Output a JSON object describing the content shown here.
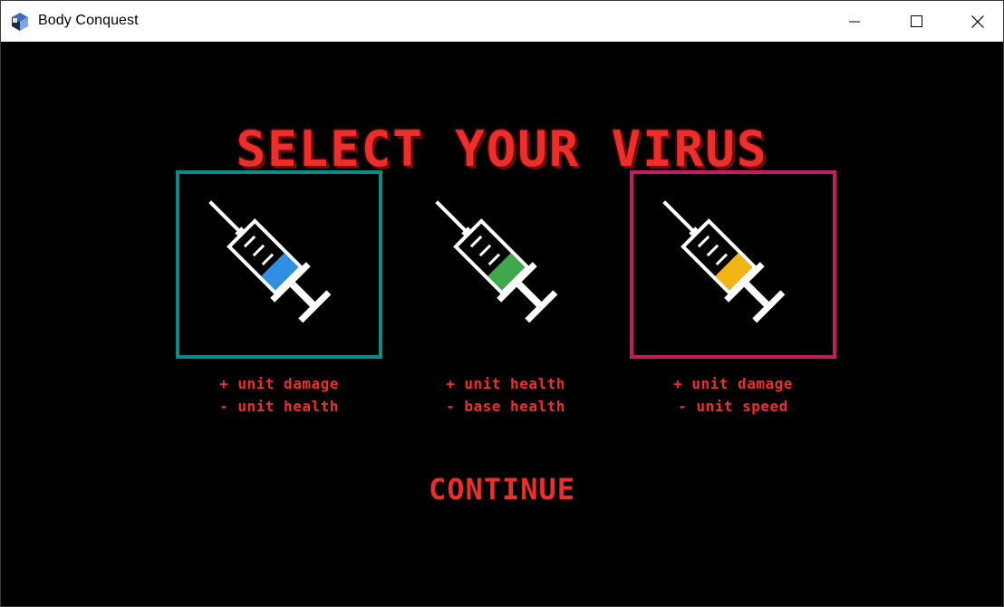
{
  "window": {
    "title": "Body Conquest",
    "app_icon": "cube-app-icon"
  },
  "controls": {
    "minimize": "minimize-icon",
    "maximize": "maximize-icon",
    "close": "close-icon"
  },
  "screen": {
    "heading": "SELECT YOUR VIRUS",
    "continue_label": "CONTINUE"
  },
  "viruses": [
    {
      "icon": "syringe-icon",
      "liquid_color": "#2f8fe0",
      "selected": true,
      "border_color": "#0e8b86",
      "plus": "+ unit damage",
      "minus": "- unit health"
    },
    {
      "icon": "syringe-icon",
      "liquid_color": "#3fa84a",
      "selected": false,
      "border_color": "",
      "plus": "+ unit health",
      "minus": "- base health"
    },
    {
      "icon": "syringe-icon",
      "liquid_color": "#f2b515",
      "selected": true,
      "border_color": "#c81a64",
      "plus": "+ unit damage",
      "minus": "- unit speed"
    }
  ],
  "colors": {
    "heading": "#ee2e2a",
    "background": "#000000"
  }
}
